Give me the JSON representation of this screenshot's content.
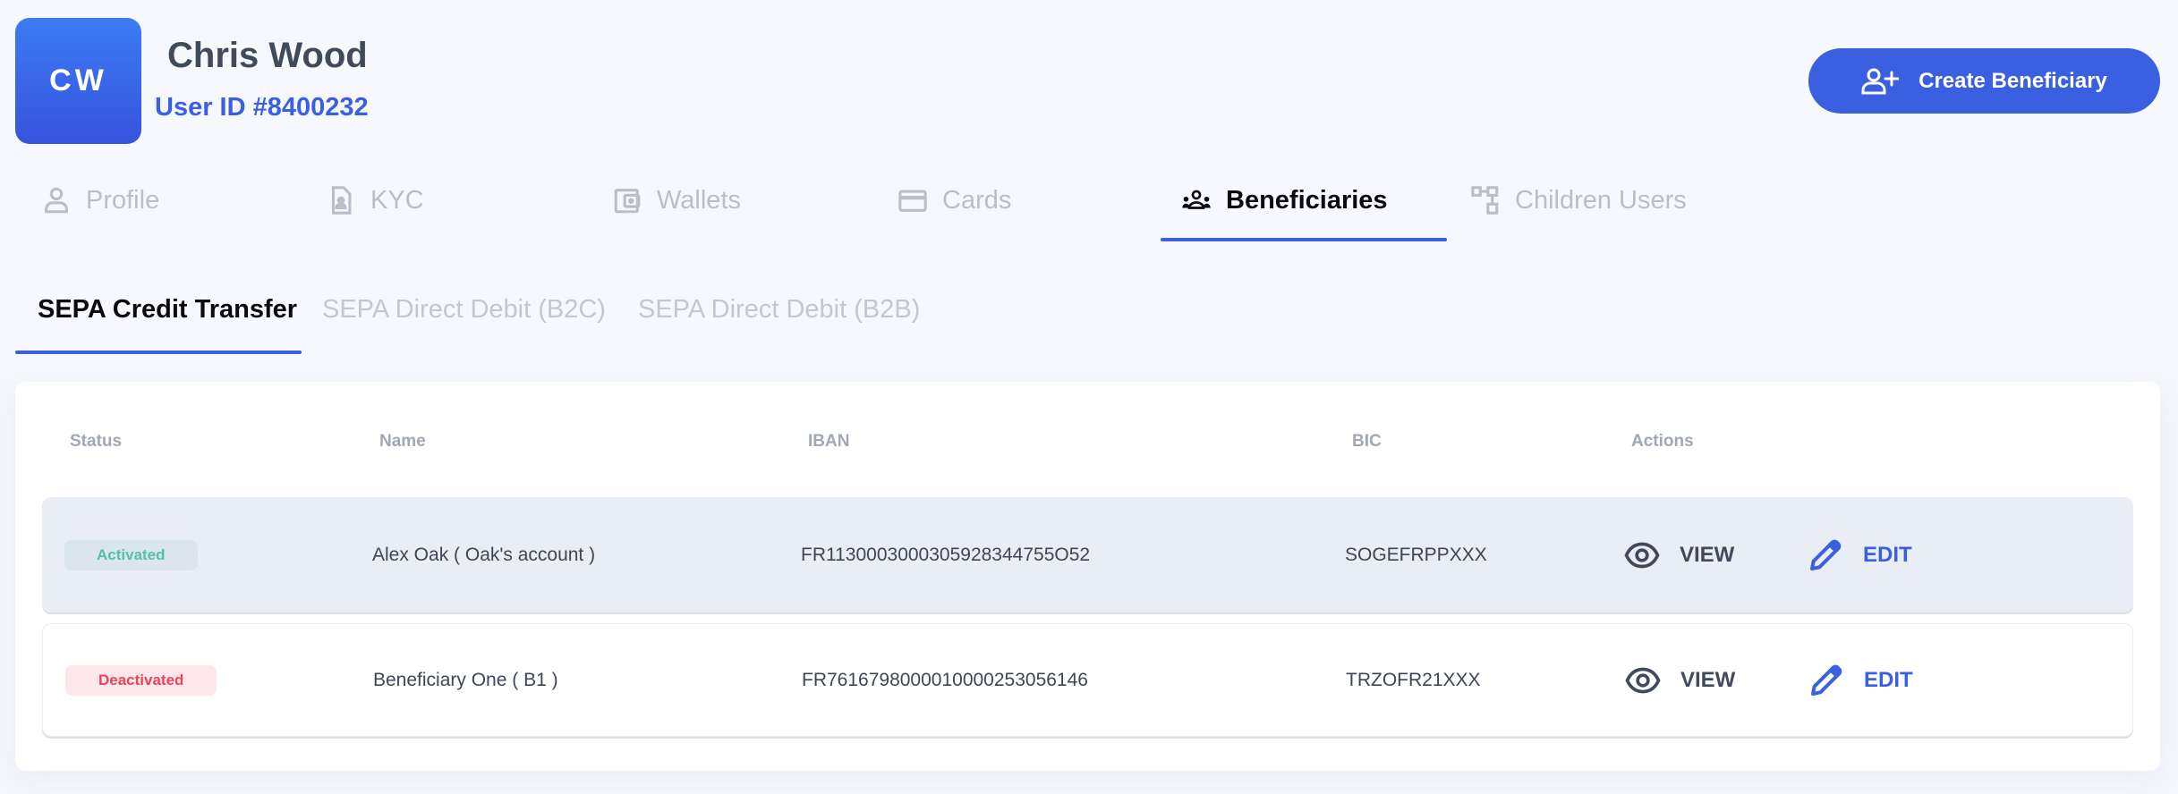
{
  "header": {
    "avatar_initials": "CW",
    "user_name": "Chris Wood",
    "user_id": "User ID #8400232",
    "create_button": {
      "label": "Create Beneficiary",
      "icon": "user-plus-icon"
    }
  },
  "colors": {
    "accent": "#3a5fe0",
    "activated_text": "#58c0a2",
    "activated_bg": "#dae5ec",
    "deactivated_text": "#ea4459",
    "deactivated_bg": "#fde7ea"
  },
  "main_tabs": [
    {
      "label": "Profile",
      "icon": "user-icon",
      "active": false
    },
    {
      "label": "KYC",
      "icon": "id-document-icon",
      "active": false
    },
    {
      "label": "Wallets",
      "icon": "wallet-icon",
      "active": false
    },
    {
      "label": "Cards",
      "icon": "credit-card-icon",
      "active": false
    },
    {
      "label": "Beneficiaries",
      "icon": "users-group-icon",
      "active": true
    },
    {
      "label": "Children Users",
      "icon": "hierarchy-icon",
      "active": false
    }
  ],
  "sub_tabs": [
    {
      "label": "SEPA Credit Transfer",
      "active": true
    },
    {
      "label": "SEPA Direct Debit (B2C)",
      "active": false
    },
    {
      "label": "SEPA Direct Debit (B2B)",
      "active": false
    }
  ],
  "table": {
    "columns": [
      "Status",
      "Name",
      "IBAN",
      "BIC",
      "Actions"
    ],
    "rows": [
      {
        "status": "Activated",
        "name": "Alex Oak ( Oak's account )",
        "iban": "FR1130003000305928344755O52",
        "bic": "SOGEFRPPXXX",
        "view_label": "VIEW",
        "edit_label": "EDIT"
      },
      {
        "status": "Deactivated",
        "name": "Beneficiary One ( B1 )",
        "iban": "FR7616798000010000253056146",
        "bic": "TRZOFR21XXX",
        "view_label": "VIEW",
        "edit_label": "EDIT"
      }
    ]
  }
}
